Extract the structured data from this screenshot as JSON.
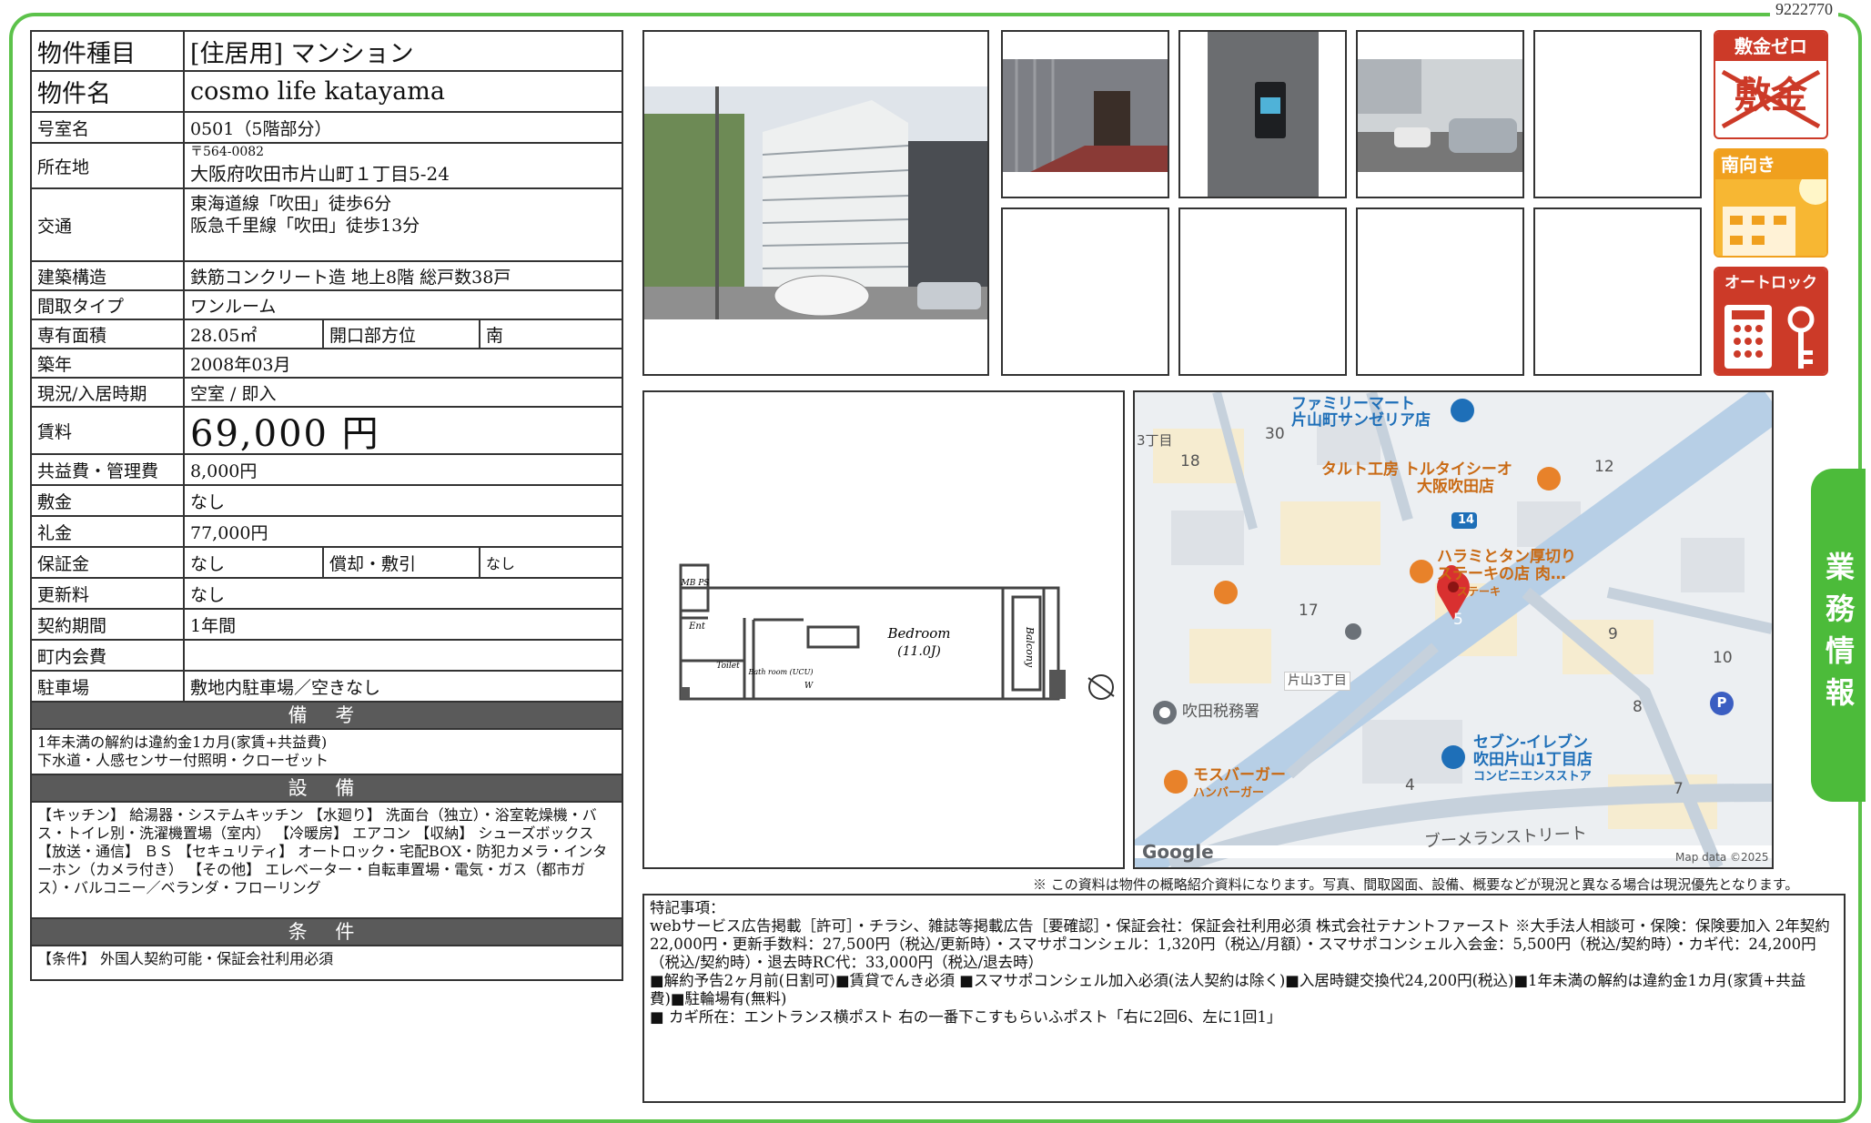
{
  "doc_id": "9222770",
  "side_tab": "業務情報",
  "info": {
    "type_label": "物件種目",
    "type_value": "[住居用] マンション",
    "name_label": "物件名",
    "name_value": "cosmo life katayama",
    "room_label": "号室名",
    "room_value": "0501（5階部分）",
    "address_label": "所在地",
    "postal": "〒564-0082",
    "address": "大阪府吹田市片山町１丁目5-24",
    "transit_label": "交通",
    "transit_1": "東海道線「吹田」徒歩6分",
    "transit_2": "阪急千里線「吹田」徒歩13分",
    "structure_label": "建築構造",
    "structure_value": "鉄筋コンクリート造 地上8階 総戸数38戸",
    "layout_label": "間取タイプ",
    "layout_value": "ワンルーム",
    "area_label": "専有面積",
    "area_value": "28.05㎡",
    "direction_label": "開口部方位",
    "direction_value": "南",
    "built_label": "築年",
    "built_value": "2008年03月",
    "status_label": "現況/入居時期",
    "status_value": "空室 / 即入",
    "rent_label": "賃料",
    "rent_value": "69,000 円",
    "fee_label": "共益費・管理費",
    "fee_value": "8,000円",
    "deposit_label": "敷金",
    "deposit_value": "なし",
    "key_money_label": "礼金",
    "key_money_value": "77,000円",
    "guarantee_label": "保証金",
    "guarantee_value": "なし",
    "amort_label": "償却・敷引",
    "amort_value": "なし",
    "renewal_label": "更新料",
    "renewal_value": "なし",
    "contract_label": "契約期間",
    "contract_value": "1年間",
    "town_label": "町内会費",
    "town_value": "",
    "parking_label": "駐車場",
    "parking_value": "敷地内駐車場／空きなし"
  },
  "sections": {
    "remarks_head": "備 考",
    "remarks_1": "1年未満の解約は違約金1カ月(家賃+共益費)",
    "remarks_2": "下水道・人感センサー付照明・クローゼット",
    "equipment_head": "設 備",
    "equipment_text": "【キッチン】 給湯器・システムキッチン 【水廻り】 洗面台（独立）・浴室乾燥機・バス・トイレ別・洗濯機置場（室内） 【冷暖房】 エアコン 【収納】 シューズボックス 【放送・通信】 ＢＳ 【セキュリティ】 オートロック・宅配BOX・防犯カメラ・インターホン（カメラ付き） 【その他】 エレベーター・自転車置場・電気・ガス（都市ガス）・バルコニー／ベランダ・フローリング",
    "conditions_head": "条 件",
    "conditions_text": "【条件】 外国人契約可能・保証会社利用必須"
  },
  "badges": {
    "zero_deposit_title": "敷金ゼロ",
    "zero_deposit_struck": "敷金",
    "south_title": "南向き",
    "autolock_title": "オートロック"
  },
  "floorplan": {
    "mb_ps": "MB PS",
    "ent": "Ent",
    "toilet": "Toilet",
    "bath": "Bath room (UCU)",
    "w": "W",
    "bedroom": "Bedroom",
    "bedroom_size": "(11.0J)",
    "balcony": "Balcony"
  },
  "map": {
    "poi_family_mart": "ファミリーマート",
    "poi_saizeriya": "片山町サンゼリア店",
    "poi_tarte_1": "タルト工房 トルタイシーオ",
    "poi_tarte_2": "大阪吹田店",
    "poi_harami_1": "ハラミとタン厚切り",
    "poi_harami_2": "ステーキの店 肉…",
    "poi_harami_3": "ステーキ",
    "poi_tax_office": "吹田税務署",
    "bus_stop": "片山3丁目",
    "poi_seven_1": "セブン-イレブン",
    "poi_seven_2": "吹田片山1丁目店",
    "poi_seven_3": "コンビニエンスストア",
    "poi_mos_1": "モスバーガー",
    "poi_mos_2": "ハンバーガー",
    "street": "ブーメランストリート",
    "chome": "3丁目",
    "route": "14",
    "parking_p": "P",
    "google": "Google",
    "attribution": "Map data ©2025",
    "numbers": [
      "30",
      "18",
      "12",
      "17",
      "9",
      "10",
      "8",
      "4",
      "7",
      "5"
    ]
  },
  "disclaimer": "※ この資料は物件の概略紹介資料になります。写真、間取図面、設備、概要などが現況と異なる場合は現況優先となります。",
  "special": {
    "heading": "特記事項：",
    "line_1": "webサービス広告掲載［許可］・チラシ、雑誌等掲載広告［要確認］・保証会社：保証会社利用必須 株式会社テナントファースト ※大手法人相談可・保険：保険要加入 2年契約 22,000円・更新手数料：27,500円（税込/更新時）・スマサポコンシェル：1,320円（税込/月額）・スマサポコンシェル入会金：5,500円（税込/契約時）・カギ代：24,200円（税込/契約時）・退去時RC代：33,000円（税込/退去時）",
    "line_2": "■解約予告2ヶ月前(日割可)■賃貸でんき必須 ■スマサポコンシェル加入必須(法人契約は除く)■入居時鍵交換代24,200円(税込)■1年未満の解約は違約金1カ月(家賃+共益費)■駐輪場有(無料)",
    "line_3": "■ カギ所在：エントランス横ポスト 右の一番下こすもらいふポスト「右に2回6、左に1回1」"
  }
}
